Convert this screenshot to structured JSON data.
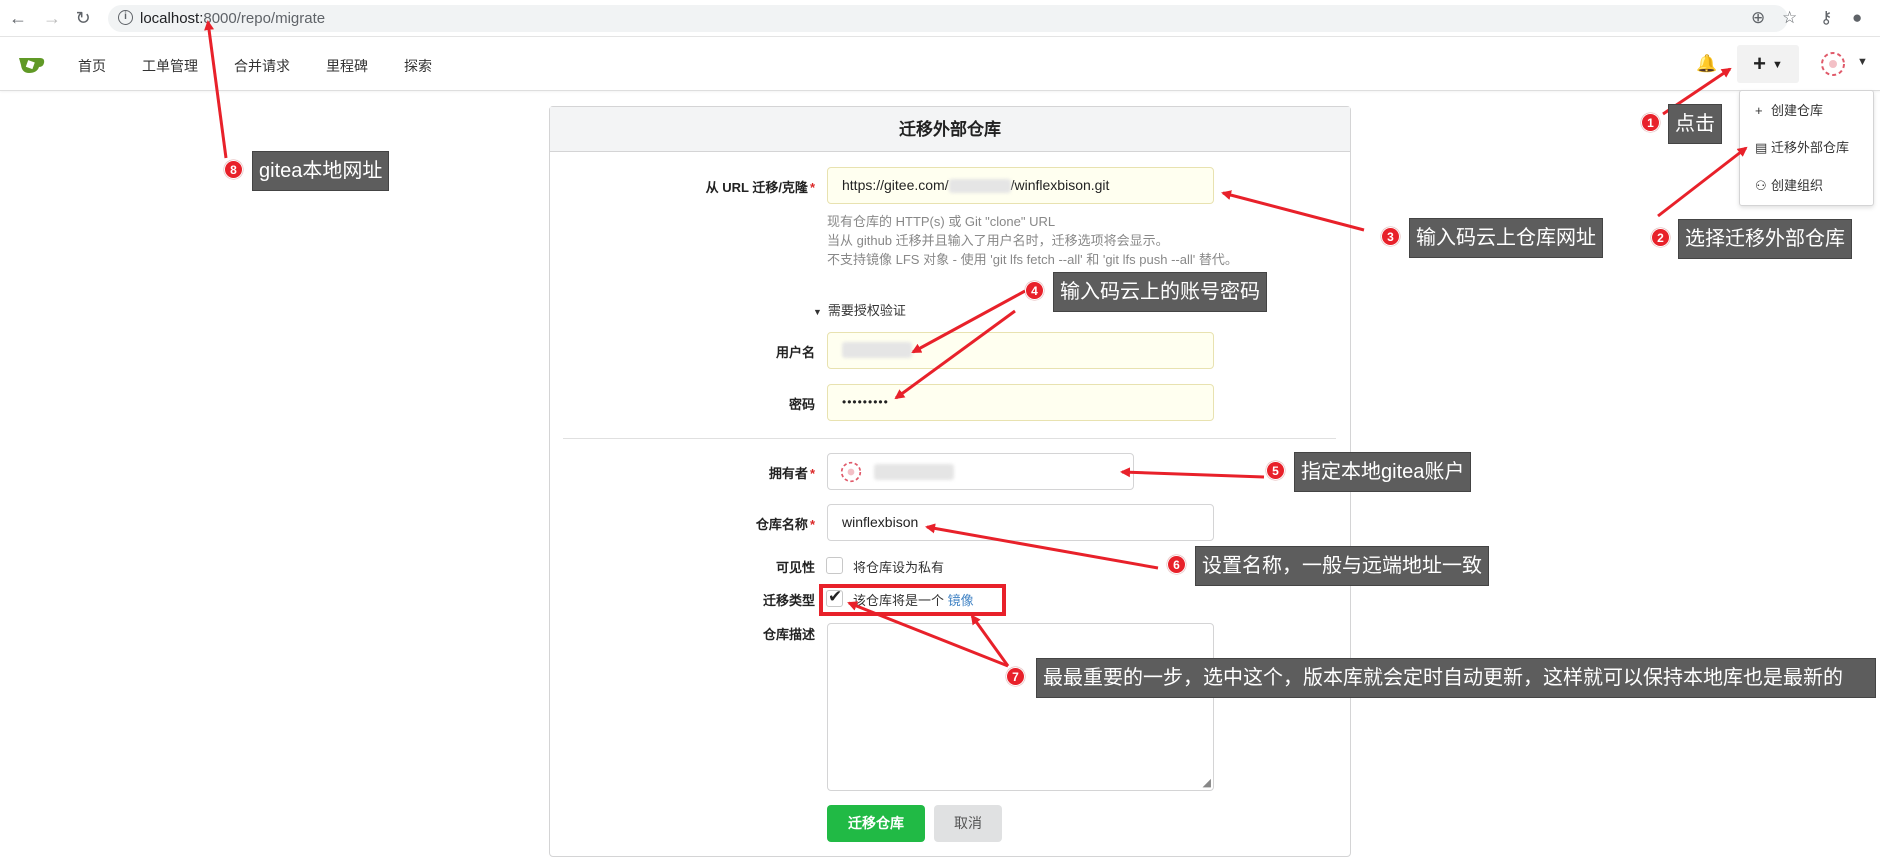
{
  "browser": {
    "url_host": "localhost:",
    "url_rest": "8000/repo/migrate"
  },
  "nav": {
    "items": [
      "首页",
      "工单管理",
      "合并请求",
      "里程碑",
      "探索"
    ],
    "plus_label": "+"
  },
  "dropdown": {
    "items": [
      "创建仓库",
      "迁移外部仓库",
      "创建组织"
    ]
  },
  "form": {
    "title": "迁移外部仓库",
    "url_label": "从 URL 迁移/克隆",
    "url_prefix": "https://gitee.com/",
    "url_suffix": "/winflexbison.git",
    "help_lines": [
      "现有仓库的 HTTP(s) 或 Git \"clone\" URL",
      "当从 github 迁移并且输入了用户名时，迁移选项将会显示。",
      "不支持镜像 LFS 对象 - 使用 'git lfs fetch --all' 和 'git lfs push --all' 替代。"
    ],
    "auth_toggle": "需要授权验证",
    "username_label": "用户名",
    "password_label": "密码",
    "password_value": "•••••••••",
    "owner_label": "拥有者",
    "repo_name_label": "仓库名称",
    "repo_name_value": "winflexbison",
    "visibility_label": "可见性",
    "visibility_text": "将仓库设为私有",
    "visibility_checked": false,
    "migrate_type_label": "迁移类型",
    "migrate_type_text": "该仓库将是一个",
    "migrate_type_link": "镜像",
    "migrate_type_checked": true,
    "desc_label": "仓库描述",
    "submit_label": "迁移仓库",
    "cancel_label": "取消"
  },
  "annotations": [
    {
      "num": "1",
      "text": "点击"
    },
    {
      "num": "2",
      "text": "选择迁移外部仓库"
    },
    {
      "num": "3",
      "text": "输入码云上仓库网址"
    },
    {
      "num": "4",
      "text": "输入码云上的账号密码"
    },
    {
      "num": "5",
      "text": "指定本地gitea账户"
    },
    {
      "num": "6",
      "text": "设置名称，一般与远端地址一致"
    },
    {
      "num": "7",
      "text": "最最重要的一步，选中这个，版本库就会定时自动更新，这样就可以保持本地库也是最新的"
    },
    {
      "num": "8",
      "text": "gitea本地网址"
    }
  ],
  "colors": {
    "accent_green": "#21ba45",
    "annotation_red": "#e8212a",
    "annotation_bg": "#5d5d5d",
    "link_blue": "#4183c4"
  }
}
